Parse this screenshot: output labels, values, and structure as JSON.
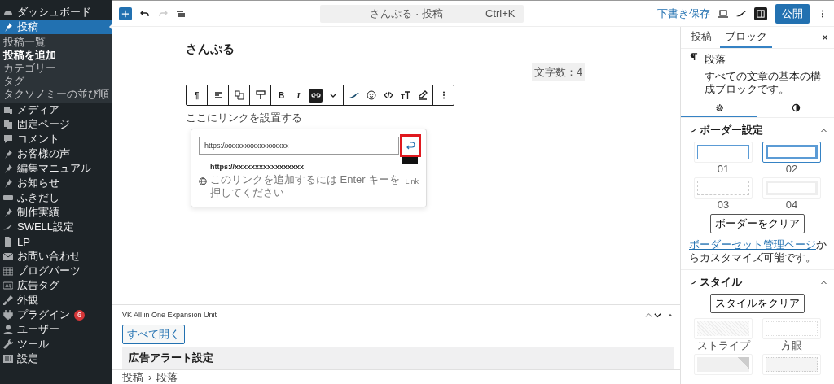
{
  "sidebar": {
    "items": [
      {
        "label": "ダッシュボード",
        "selected": false
      },
      {
        "label": "投稿",
        "selected": true,
        "children": [
          {
            "label": "投稿一覧",
            "selected": false
          },
          {
            "label": "投稿を追加",
            "selected": true
          },
          {
            "label": "カテゴリー",
            "selected": false
          },
          {
            "label": "タグ",
            "selected": false
          },
          {
            "label": "タクソノミーの並び順",
            "selected": false
          }
        ]
      },
      {
        "label": "メディア",
        "selected": false
      },
      {
        "label": "固定ページ",
        "selected": false
      },
      {
        "label": "コメント",
        "selected": false
      },
      {
        "label": "お客様の声",
        "selected": false
      },
      {
        "label": "編集マニュアル",
        "selected": false
      },
      {
        "label": "お知らせ",
        "selected": false
      },
      {
        "label": "ふきだし",
        "selected": false
      },
      {
        "label": "制作実績",
        "selected": false
      },
      {
        "label": "SWELL設定",
        "selected": false
      },
      {
        "label": "LP",
        "selected": false
      },
      {
        "label": "お問い合わせ",
        "selected": false
      },
      {
        "label": "ブログパーツ",
        "selected": false
      },
      {
        "label": "広告タグ",
        "selected": false
      },
      {
        "label": "外観",
        "selected": false
      },
      {
        "label": "プラグイン",
        "selected": false,
        "badge": "6"
      },
      {
        "label": "ユーザー",
        "selected": false
      },
      {
        "label": "ツール",
        "selected": false
      },
      {
        "label": "設定",
        "selected": false
      }
    ]
  },
  "topbar": {
    "document_title": "さんぷる · 投稿",
    "shortcut": "Ctrl+K",
    "save_draft": "下書き保存",
    "sidebar_toggle": {
      "selected": true
    },
    "publish": "公開"
  },
  "editor": {
    "title": "さんぷる",
    "word_count": "文字数：4",
    "toolbar": {
      "groups": [
        [
          {
            "label": "¶",
            "selected": false
          }
        ],
        [
          {
            "selected": false
          }
        ],
        [
          {
            "selected": false
          }
        ],
        [
          {
            "selected": false
          }
        ],
        [
          {
            "label": "B",
            "selected": false
          },
          {
            "label": "I",
            "selected": false
          },
          {
            "selected": true
          },
          {
            "selected": false
          }
        ],
        [
          {
            "selected": false
          },
          {
            "selected": false
          },
          {
            "selected": false
          },
          {
            "selected": false
          },
          {
            "selected": false
          }
        ],
        [
          {
            "selected": false
          }
        ]
      ]
    },
    "paragraph": "ここにリンクを設置する",
    "link_popup": {
      "url_value": "https://xxxxxxxxxxxxxxxxx",
      "submit_highlighted": true,
      "suggestion_title": "https://xxxxxxxxxxxxxxxxx",
      "suggestion_hint": "このリンクを追加するには Enter キーを押してください",
      "suggestion_type": "Link"
    }
  },
  "metabox": {
    "title": "VK All in One Expansion Unit",
    "expand_all": "すべて開く",
    "sections": [
      "広告アラート設定"
    ]
  },
  "breadcrumb": {
    "items": [
      "投稿",
      "段落"
    ],
    "separator": "›"
  },
  "panel": {
    "tabs": [
      {
        "label": "投稿",
        "selected": false
      },
      {
        "label": "ブロック",
        "selected": true
      }
    ],
    "block": {
      "name": "段落",
      "description": "すべての文章の基本の構成ブロックです。"
    },
    "settings_tabs": [
      {
        "selected": true
      },
      {
        "selected": false
      }
    ],
    "border_settings": {
      "title": "ボーダー設定",
      "options": [
        {
          "label": "01",
          "selected": false
        },
        {
          "label": "02",
          "selected": true
        },
        {
          "label": "03",
          "selected": false
        },
        {
          "label": "04",
          "selected": false
        }
      ],
      "clear": "ボーダーをクリア",
      "note_link": "ボーダーセット管理ページ",
      "note": "からカスタマイズ可能です。"
    },
    "style": {
      "title": "スタイル",
      "clear": "スタイルをクリア",
      "options": [
        {
          "label": "ストライプ",
          "selected": false
        },
        {
          "label": "方眼",
          "selected": false
        },
        {
          "selected": false
        },
        {
          "selected": false
        }
      ]
    }
  }
}
